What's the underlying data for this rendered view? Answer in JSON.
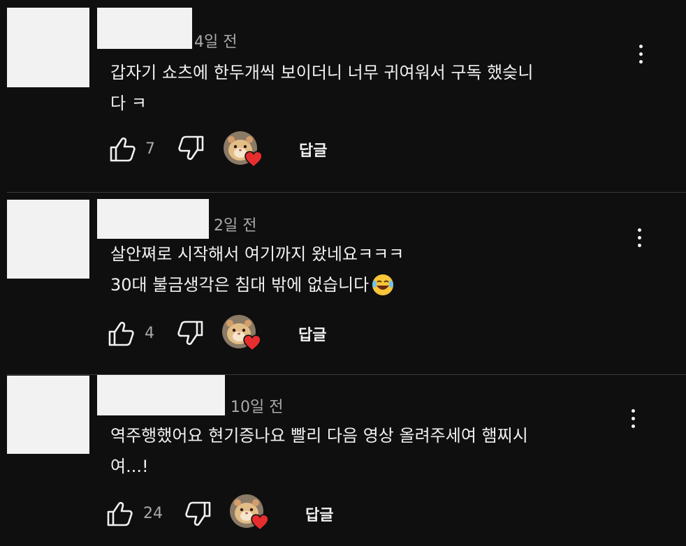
{
  "comments": [
    {
      "time": "4일 전",
      "lines": [
        "갑자기 쇼츠에 한두개씩 보이더니 너무 귀여워서 구독 했슺니",
        "다 ㅋ"
      ],
      "likes": "7",
      "reply": "답글"
    },
    {
      "time": "2일 전",
      "lines": [
        "살안쪄로 시작해서 여기까지 왔네요ㅋㅋㅋ",
        "30대 불금생각은 침대 밖에 없습니다"
      ],
      "likes": "4",
      "reply": "답글"
    },
    {
      "time": "10일 전",
      "lines": [
        "역주행했어요 현기증나요 빨리 다음 영상 올려주세여 햄찌시",
        "여...!"
      ],
      "likes": "24",
      "reply": "답글"
    }
  ],
  "icons": {
    "more": "more-vert-icon",
    "like": "thumb-up-icon",
    "dislike": "thumb-down-icon",
    "creator_heart": "creator-heart-icon",
    "emoji": "laughing-tears-emoji"
  },
  "colors": {
    "background": "#0f0f0f",
    "text": "#f1f1f1",
    "meta": "#aaaaaa",
    "heart": "#e62e2e"
  }
}
